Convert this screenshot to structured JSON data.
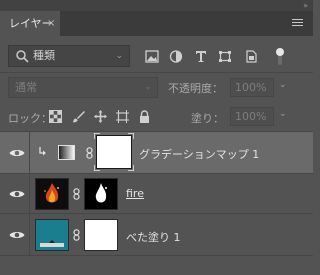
{
  "panel": {
    "tab_label": "レイヤー",
    "tab_close": "×",
    "collapse_glyph": "»"
  },
  "filter": {
    "kind_label": "種類",
    "icons": [
      "image-filter-icon",
      "adjustment-filter-icon",
      "type-filter-icon",
      "shape-filter-icon",
      "smart-object-filter-icon"
    ]
  },
  "blend": {
    "mode": "通常",
    "opacity_label": "不透明度：",
    "opacity_value": "100%"
  },
  "locks": {
    "label": "ロック：",
    "icons": [
      "lock-transparent-icon",
      "lock-image-icon",
      "lock-position-icon",
      "lock-artboard-icon",
      "lock-all-icon"
    ],
    "fill_label": "塗り：",
    "fill_value": "100%"
  },
  "layers": [
    {
      "name": "グラデーションマップ 1",
      "type": "adjustment",
      "visible": true,
      "selected": true,
      "clipped": true
    },
    {
      "name": "fire",
      "type": "image",
      "visible": true,
      "selected": false,
      "clipped": false
    },
    {
      "name": "べた塗り 1",
      "type": "fill",
      "visible": true,
      "selected": false,
      "clipped": false,
      "fill_color": "#1b7e8f"
    }
  ],
  "colors": {
    "panel_bg": "#535353",
    "selected_row": "#6a6a6a",
    "fill_layer_color": "#1b7e8f"
  }
}
